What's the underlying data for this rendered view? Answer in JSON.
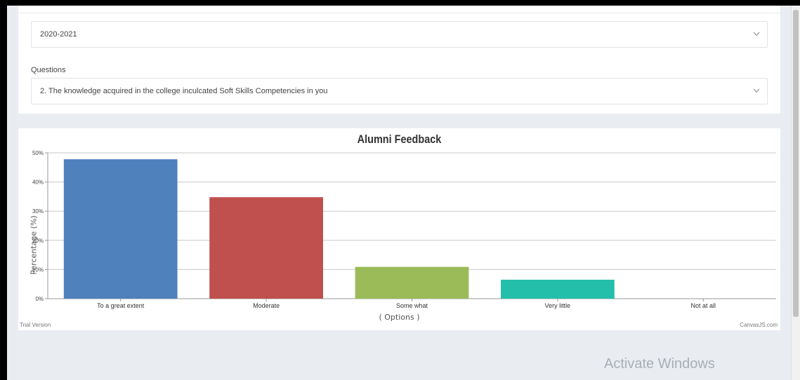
{
  "filters": {
    "year": "2020-2021",
    "questions_label": "Questions",
    "question": "2. The knowledge acquired in the college inculcated Soft Skills Competencies in you"
  },
  "chart_data": {
    "type": "bar",
    "title": "Alumni Feedback",
    "xlabel": "( Options )",
    "ylabel": "Percentage (%)",
    "categories": [
      "To a great extent",
      "Moderate",
      "Some what",
      "Very little",
      "Not at all"
    ],
    "values": [
      47.8,
      34.8,
      10.9,
      6.5,
      0
    ],
    "colors": [
      "#4f81bc",
      "#c0504e",
      "#9bbb58",
      "#23bfaa",
      "#8064a1"
    ],
    "ylim": [
      0,
      50
    ],
    "yticks": [
      0,
      10,
      20,
      30,
      40,
      50
    ],
    "ytick_labels": [
      "0%",
      "10%",
      "20%",
      "30%",
      "40%",
      "50%"
    ],
    "grid": true
  },
  "chart_footer": {
    "left": "Trial Version",
    "right": "CanvasJS.com"
  },
  "watermark": "Activate Windows"
}
